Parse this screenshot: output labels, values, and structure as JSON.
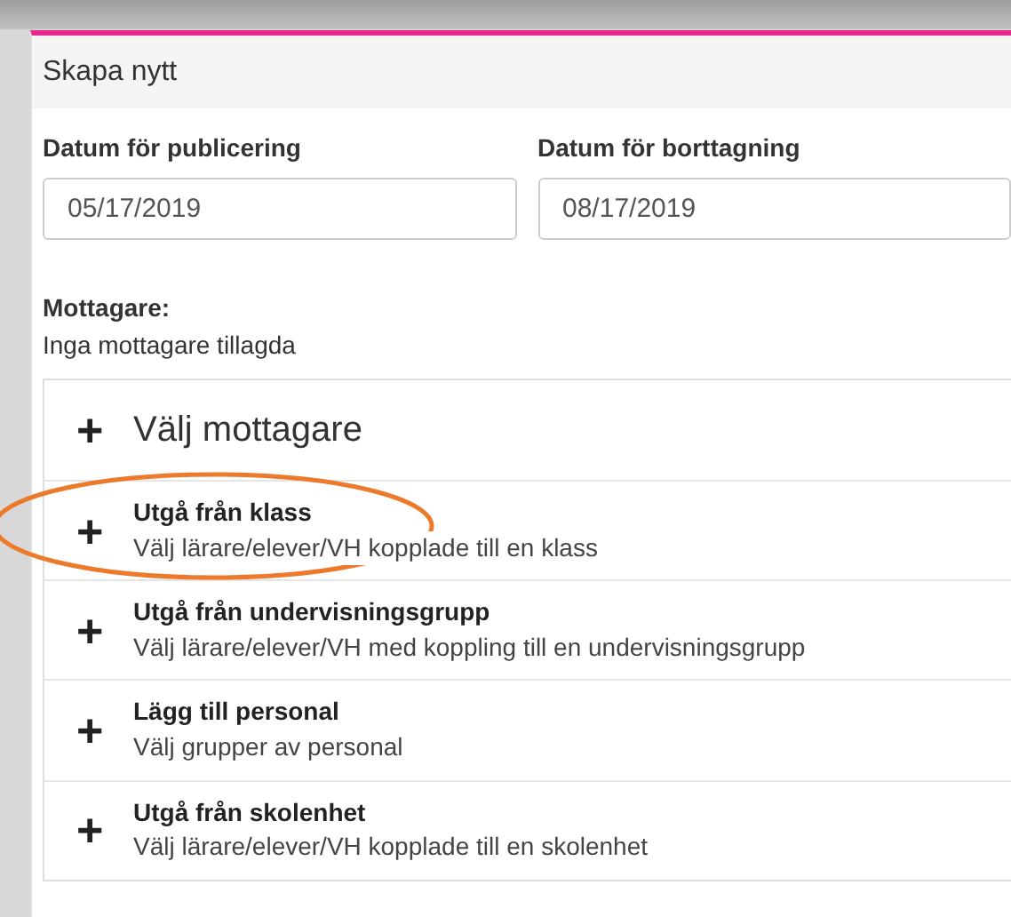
{
  "panel": {
    "title": "Skapa nytt"
  },
  "dates": [
    {
      "label": "Datum för publicering",
      "value": "05/17/2019"
    },
    {
      "label": "Datum för borttagning",
      "value": "08/17/2019"
    }
  ],
  "recipients": {
    "label": "Mottagare:",
    "status": "Inga mottagare tillagda"
  },
  "options": [
    {
      "kind": "header",
      "icon": "+",
      "title": "Välj mottagare",
      "highlighted": false
    },
    {
      "kind": "option",
      "icon": "+",
      "title": "Utgå från klass",
      "description": "Välj lärare/elever/VH kopplade till en klass",
      "highlighted": true
    },
    {
      "kind": "option",
      "icon": "+",
      "title": "Utgå från undervisningsgrupp",
      "description": "Välj lärare/elever/VH med koppling till en undervisningsgrupp",
      "highlighted": false
    },
    {
      "kind": "option",
      "icon": "+",
      "title": "Lägg till personal",
      "description": "Välj grupper av personal",
      "highlighted": false
    },
    {
      "kind": "option",
      "icon": "+",
      "title": "Utgå från skolenhet",
      "description": "Välj lärare/elever/VH kopplade till en skolenhet",
      "highlighted": false
    }
  ]
}
